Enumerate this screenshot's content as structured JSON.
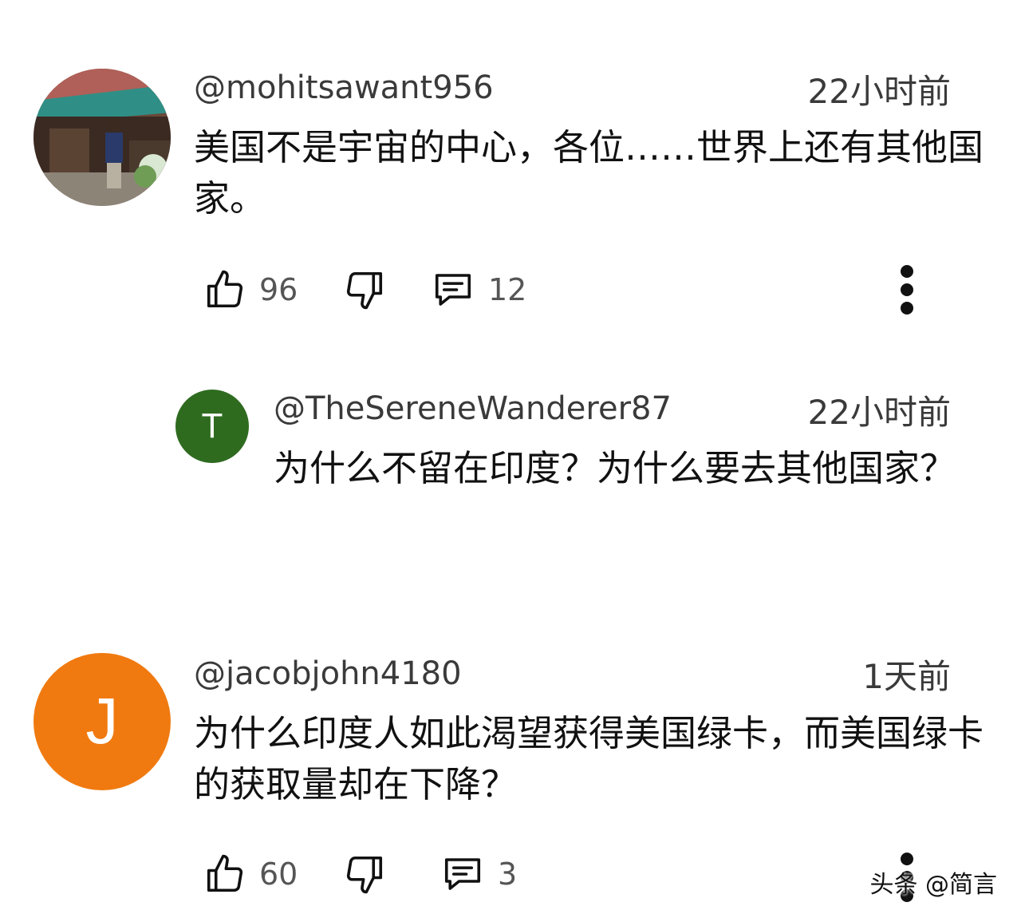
{
  "comments": [
    {
      "handle": "@mohitsawant956",
      "time": "22小时前",
      "text": "美国不是宇宙的中心，各位……世界上还有其他国家。",
      "avatar": {
        "type": "photo"
      },
      "likes": "96",
      "replies": "12"
    },
    {
      "handle": "@TheSereneWanderer87",
      "time": "22小时前",
      "text": "为什么不留在印度？为什么要去其他国家？",
      "avatar": {
        "type": "letter",
        "letter": "T",
        "color": "#2e6b1f"
      }
    },
    {
      "handle": "@jacobjohn4180",
      "time": "1天前",
      "text": "为什么印度人如此渴望获得美国绿卡，而美国绿卡的获取量却在下降？",
      "avatar": {
        "type": "letter",
        "letter": "J",
        "color": "#f07a10"
      },
      "likes": "60",
      "replies": "3"
    }
  ],
  "icons": {
    "like": "thumbs-up-icon",
    "dislike": "thumbs-down-icon",
    "reply": "comment-icon",
    "more": "more-vertical-icon"
  },
  "watermark": "头条 @简言"
}
